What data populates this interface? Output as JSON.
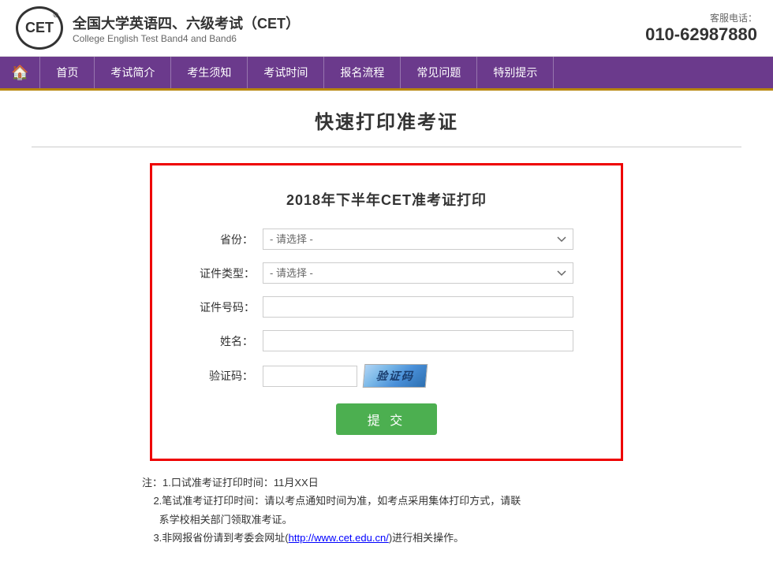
{
  "header": {
    "logo_text": "CET",
    "logo_registered": "®",
    "title_cn": "全国大学英语四、六级考试（CET）",
    "title_en": "College English Test Band4 and Band6",
    "contact_label": "客服电话：",
    "contact_phone": "010-62987880"
  },
  "navbar": {
    "home_icon": "🏠",
    "items": [
      {
        "label": "首页"
      },
      {
        "label": "考试简介"
      },
      {
        "label": "考生须知"
      },
      {
        "label": "考试时间"
      },
      {
        "label": "报名流程"
      },
      {
        "label": "常见问题"
      },
      {
        "label": "特别提示"
      }
    ]
  },
  "page": {
    "title": "快速打印准考证",
    "form": {
      "title": "2018年下半年CET准考证打印",
      "fields": [
        {
          "label": "省份：",
          "type": "select",
          "placeholder": "- 请选择 -"
        },
        {
          "label": "证件类型：",
          "type": "select",
          "placeholder": "- 请选择 -"
        },
        {
          "label": "证件号码：",
          "type": "text",
          "placeholder": ""
        },
        {
          "label": "姓名：",
          "type": "text",
          "placeholder": ""
        },
        {
          "label": "验证码：",
          "type": "captcha",
          "captcha_text": "验证码"
        }
      ],
      "submit_label": "提  交"
    },
    "notes": {
      "prefix": "注：",
      "items": [
        "1.口试准考证打印时间：11月XX日",
        "2.笔试准考证打印时间：请以考点通知时间为准，如考点采用集体打印方式，请联系学校相关部门领取准考证。",
        "3.非网报省份请到考委会网址(",
        ")进行相关操作。"
      ],
      "link_text": "http://www.cet.edu.cn/",
      "link_url": "http://www.cet.edu.cn/"
    }
  }
}
